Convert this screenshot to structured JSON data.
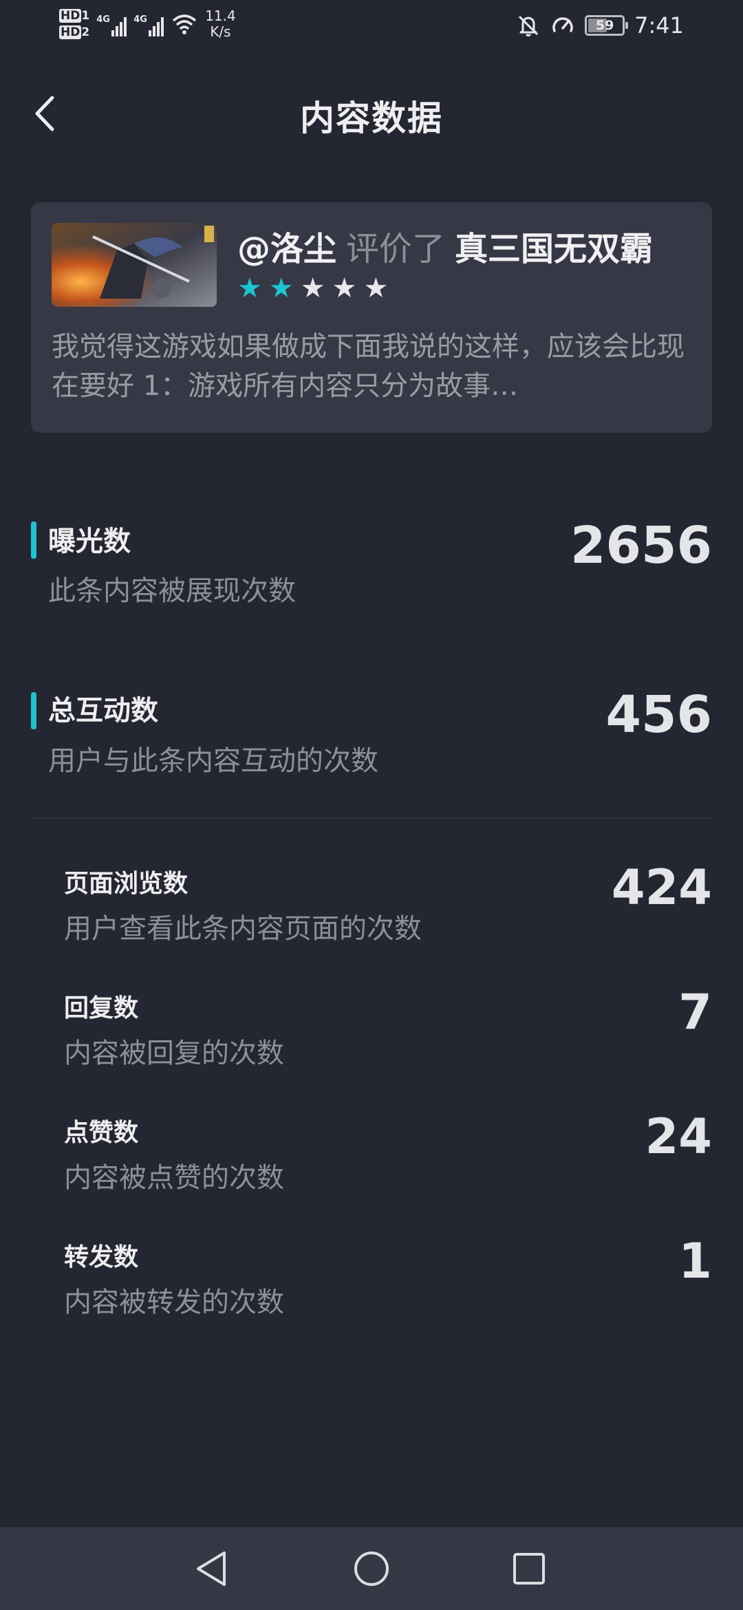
{
  "status_bar": {
    "hd1": "HD",
    "hd1_sub": "1",
    "hd2": "HD",
    "hd2_sub": "2",
    "sig1": "4G",
    "sig2": "4G",
    "speed_value": "11.4",
    "speed_unit": "K/s",
    "battery": "59",
    "battery_level": 0.59,
    "time": "7:41"
  },
  "header": {
    "title": "内容数据",
    "back_icon": "chevron-left-icon"
  },
  "review_card": {
    "user": "@洛尘",
    "verb": "评价了",
    "game": "真三国无双霸",
    "rating": 2,
    "rating_max": 5,
    "star_on_color": "#1cc3d1",
    "excerpt": "我觉得这游戏如果做成下面我说的这样，应该会比现在要好 1：游戏所有内容只分为故事…"
  },
  "metrics": [
    {
      "label": "曝光数",
      "desc": "此条内容被展现次数",
      "value": "2656"
    },
    {
      "label": "总互动数",
      "desc": "用户与此条内容互动的次数",
      "value": "456"
    }
  ],
  "sub_metrics": [
    {
      "label": "页面浏览数",
      "desc": "用户查看此条内容页面的次数",
      "value": "424"
    },
    {
      "label": "回复数",
      "desc": "内容被回复的次数",
      "value": "7"
    },
    {
      "label": "点赞数",
      "desc": "内容被点赞的次数",
      "value": "24"
    },
    {
      "label": "转发数",
      "desc": "内容被转发的次数",
      "value": "1"
    }
  ],
  "nav_bar": {
    "back": "triangle-back-icon",
    "home": "circle-home-icon",
    "recents": "square-recents-icon"
  }
}
